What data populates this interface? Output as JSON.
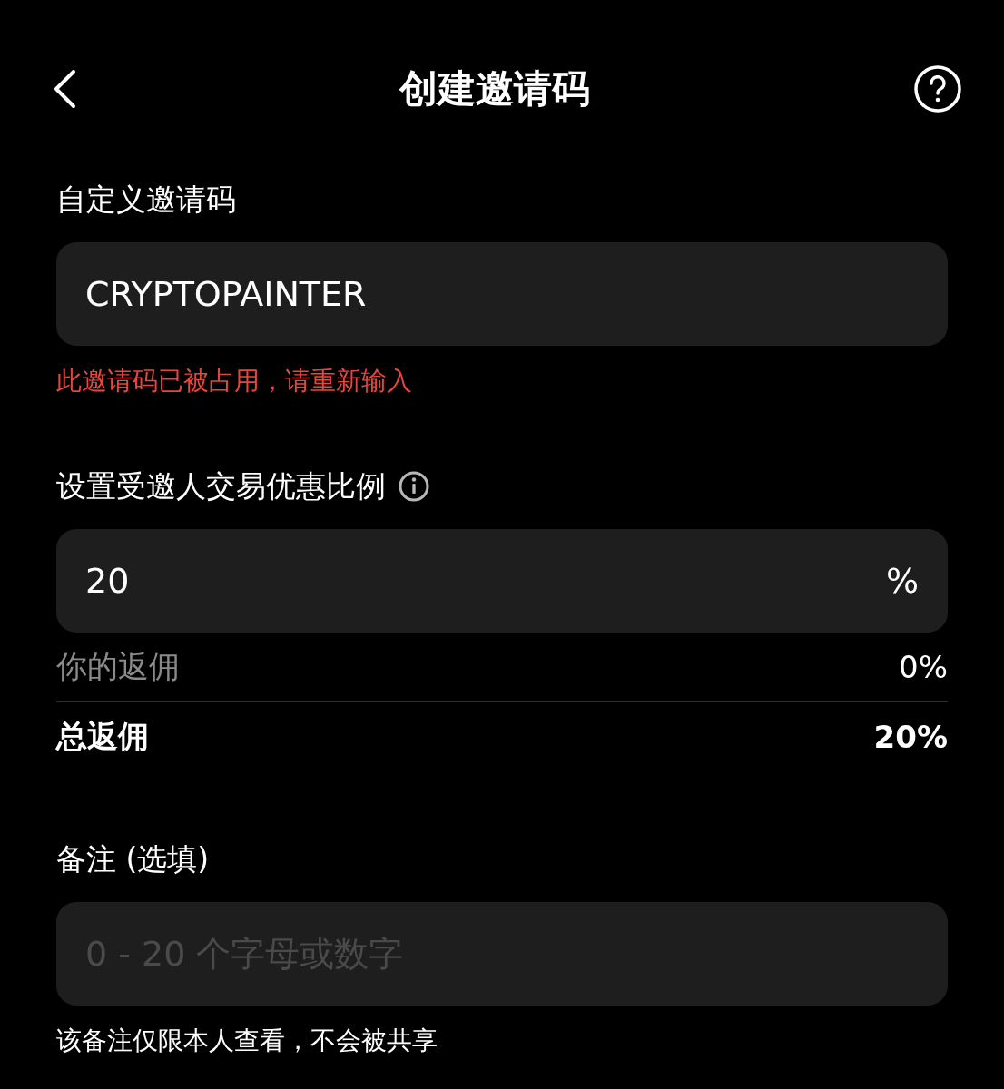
{
  "header": {
    "title": "创建邀请码"
  },
  "sections": [
    {
      "label": "自定义邀请码",
      "info": false,
      "field": {
        "value": "CRYPTOPAINTER"
      },
      "notes": [
        {
          "kind": "error",
          "text": "此邀请码已被占用，请重新输入"
        }
      ]
    },
    {
      "label": "设置受邀人交易优惠比例",
      "info": true,
      "field": {
        "value": "20",
        "suffix": "%"
      },
      "rows": [
        {
          "label": "你的返佣",
          "value": "0%",
          "emphasis": false
        },
        {
          "label": "总返佣",
          "value": "20%",
          "emphasis": true
        }
      ]
    },
    {
      "label": "备注 (选填)",
      "info": false,
      "field": {
        "placeholder": "0 - 20 个字母或数字"
      },
      "notes": [
        {
          "kind": "info",
          "text": "该备注仅限本人查看，不会被共享"
        }
      ]
    }
  ]
}
